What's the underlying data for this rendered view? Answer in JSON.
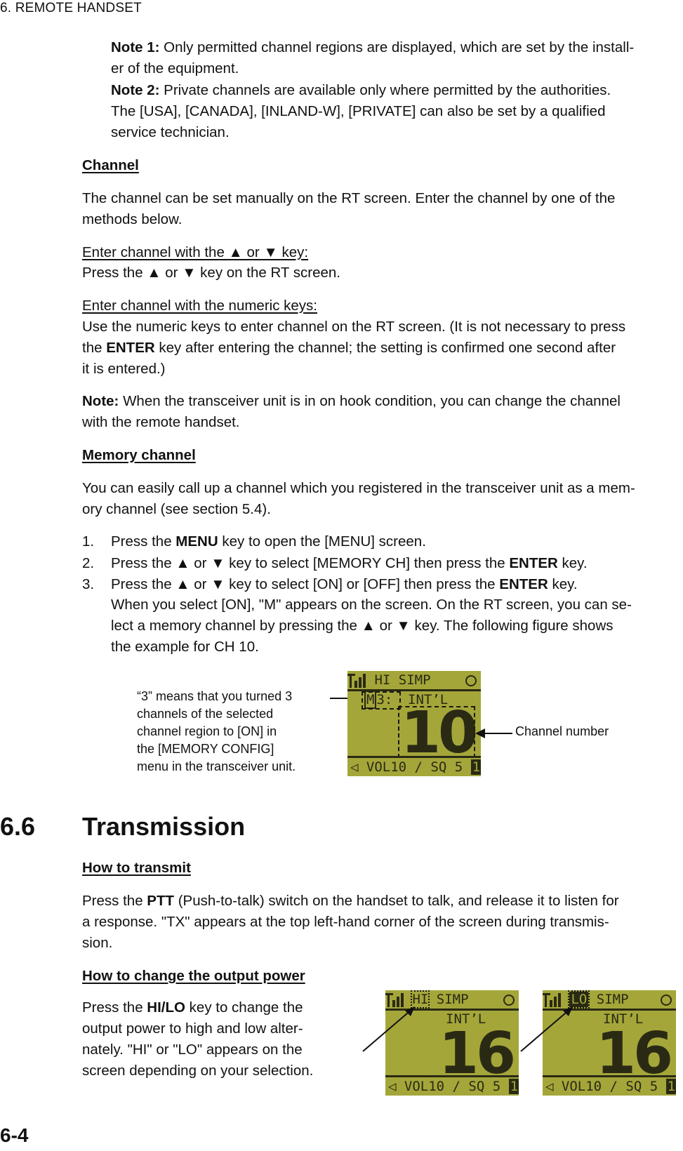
{
  "running_head": "6.  REMOTE HANDSET",
  "notes": {
    "note1_label": "Note 1:",
    "note1_line1": " Only permitted channel regions are displayed, which are set by the install-",
    "note1_line2": "er of the equipment.",
    "note2_label": "Note 2:",
    "note2_line1": " Private channels are available only where permitted by the authorities.",
    "note2_line2": "The [USA], [CANADA], [INLAND-W], [PRIVATE] can also be set by a qualified",
    "note2_line3": "service technician."
  },
  "channel": {
    "heading": "Channel",
    "intro_line1": "The channel can be set manually on the RT screen. Enter the channel by one of the",
    "intro_line2": "methods below.",
    "method1_title": "Enter channel with the ▲ or ▼ key:",
    "method1_text": "Press the ▲ or ▼ key on the RT screen.",
    "method2_title": "Enter channel with the numeric keys:",
    "method2_line1": "Use the numeric keys to enter channel on the RT screen. (It is not necessary to press",
    "method2_line2_pre": "the ",
    "method2_line2_bold": "ENTER",
    "method2_line2_post": " key after entering the channel; the setting is confirmed one second after",
    "method2_line3": "it is entered.)",
    "note_label": "Note:",
    "note_line1": " When the transceiver unit is in on hook condition, you can change the channel",
    "note_line2": "with the remote handset."
  },
  "memory_channel": {
    "heading": "Memory channel",
    "intro_line1": "You can easily call up a channel which you registered in the transceiver unit as a mem-",
    "intro_line2": "ory channel (see section 5.4).",
    "steps": [
      {
        "num": "1.",
        "pre": "Press the ",
        "bold": "MENU",
        "post": " key to open the [MENU] screen."
      },
      {
        "num": "2.",
        "pre": "Press the ▲ or ▼ key to select [MEMORY CH] then press the ",
        "bold": "ENTER",
        "post": " key."
      },
      {
        "num": "3.",
        "pre": "Press the ▲ or ▼ key to select [ON] or [OFF] then press the ",
        "bold": "ENTER",
        "post": " key."
      }
    ],
    "step3_cont_line1": "When you select [ON], \"M\" appears on the screen. On the RT screen, you can se-",
    "step3_cont_line2": "lect a memory channel by pressing the ▲ or ▼ key. The following figure shows",
    "step3_cont_line3": "the example for CH 10.",
    "figure": {
      "callout_left_lines": [
        "“3” means that you turned 3",
        "channels of the selected",
        "channel region to [ON] in",
        "the [MEMORY CONFIG]",
        "menu in the transceiver unit."
      ],
      "callout_right": "Channel number",
      "lcd": {
        "power": "HI",
        "mode": "SIMP",
        "memory_marker": "M",
        "memory_count": "3",
        "region": "INT’L",
        "channel": "10",
        "bottom": "VOL10 / SQ 5",
        "indicator": "1"
      }
    }
  },
  "transmission": {
    "number": "6.6",
    "title": "Transmission",
    "how_to_transmit": {
      "heading": "How to transmit",
      "line1_pre": "Press the ",
      "line1_bold": "PTT",
      "line1_post": " (Push-to-talk) switch on the handset to talk, and release it to listen for",
      "line2": "a response. \"TX\" appears at the top left-hand corner of the screen during transmis-",
      "line3": "sion."
    },
    "output_power": {
      "heading": "How to change the output power",
      "line1_pre": "Press the ",
      "line1_bold": "HI/LO",
      "line1_post": " key to change the",
      "line2": "output power to high and low alter-",
      "line3": "nately. \"HI\" or \"LO\" appears on the",
      "line4": "screen depending on your selection.",
      "lcd_hi": {
        "power": "HI",
        "mode": "SIMP",
        "region": "INT’L",
        "channel": "16",
        "bottom": "VOL10 / SQ 5",
        "indicator": "1"
      },
      "lcd_lo": {
        "power": "LO",
        "mode": "SIMP",
        "region": "INT’L",
        "channel": "16",
        "bottom": "VOL10 / SQ 5",
        "indicator": "1"
      }
    }
  },
  "page_number": "6-4",
  "colors": {
    "lcd_background": "#a4a63a",
    "lcd_foreground": "#2a2a14"
  }
}
